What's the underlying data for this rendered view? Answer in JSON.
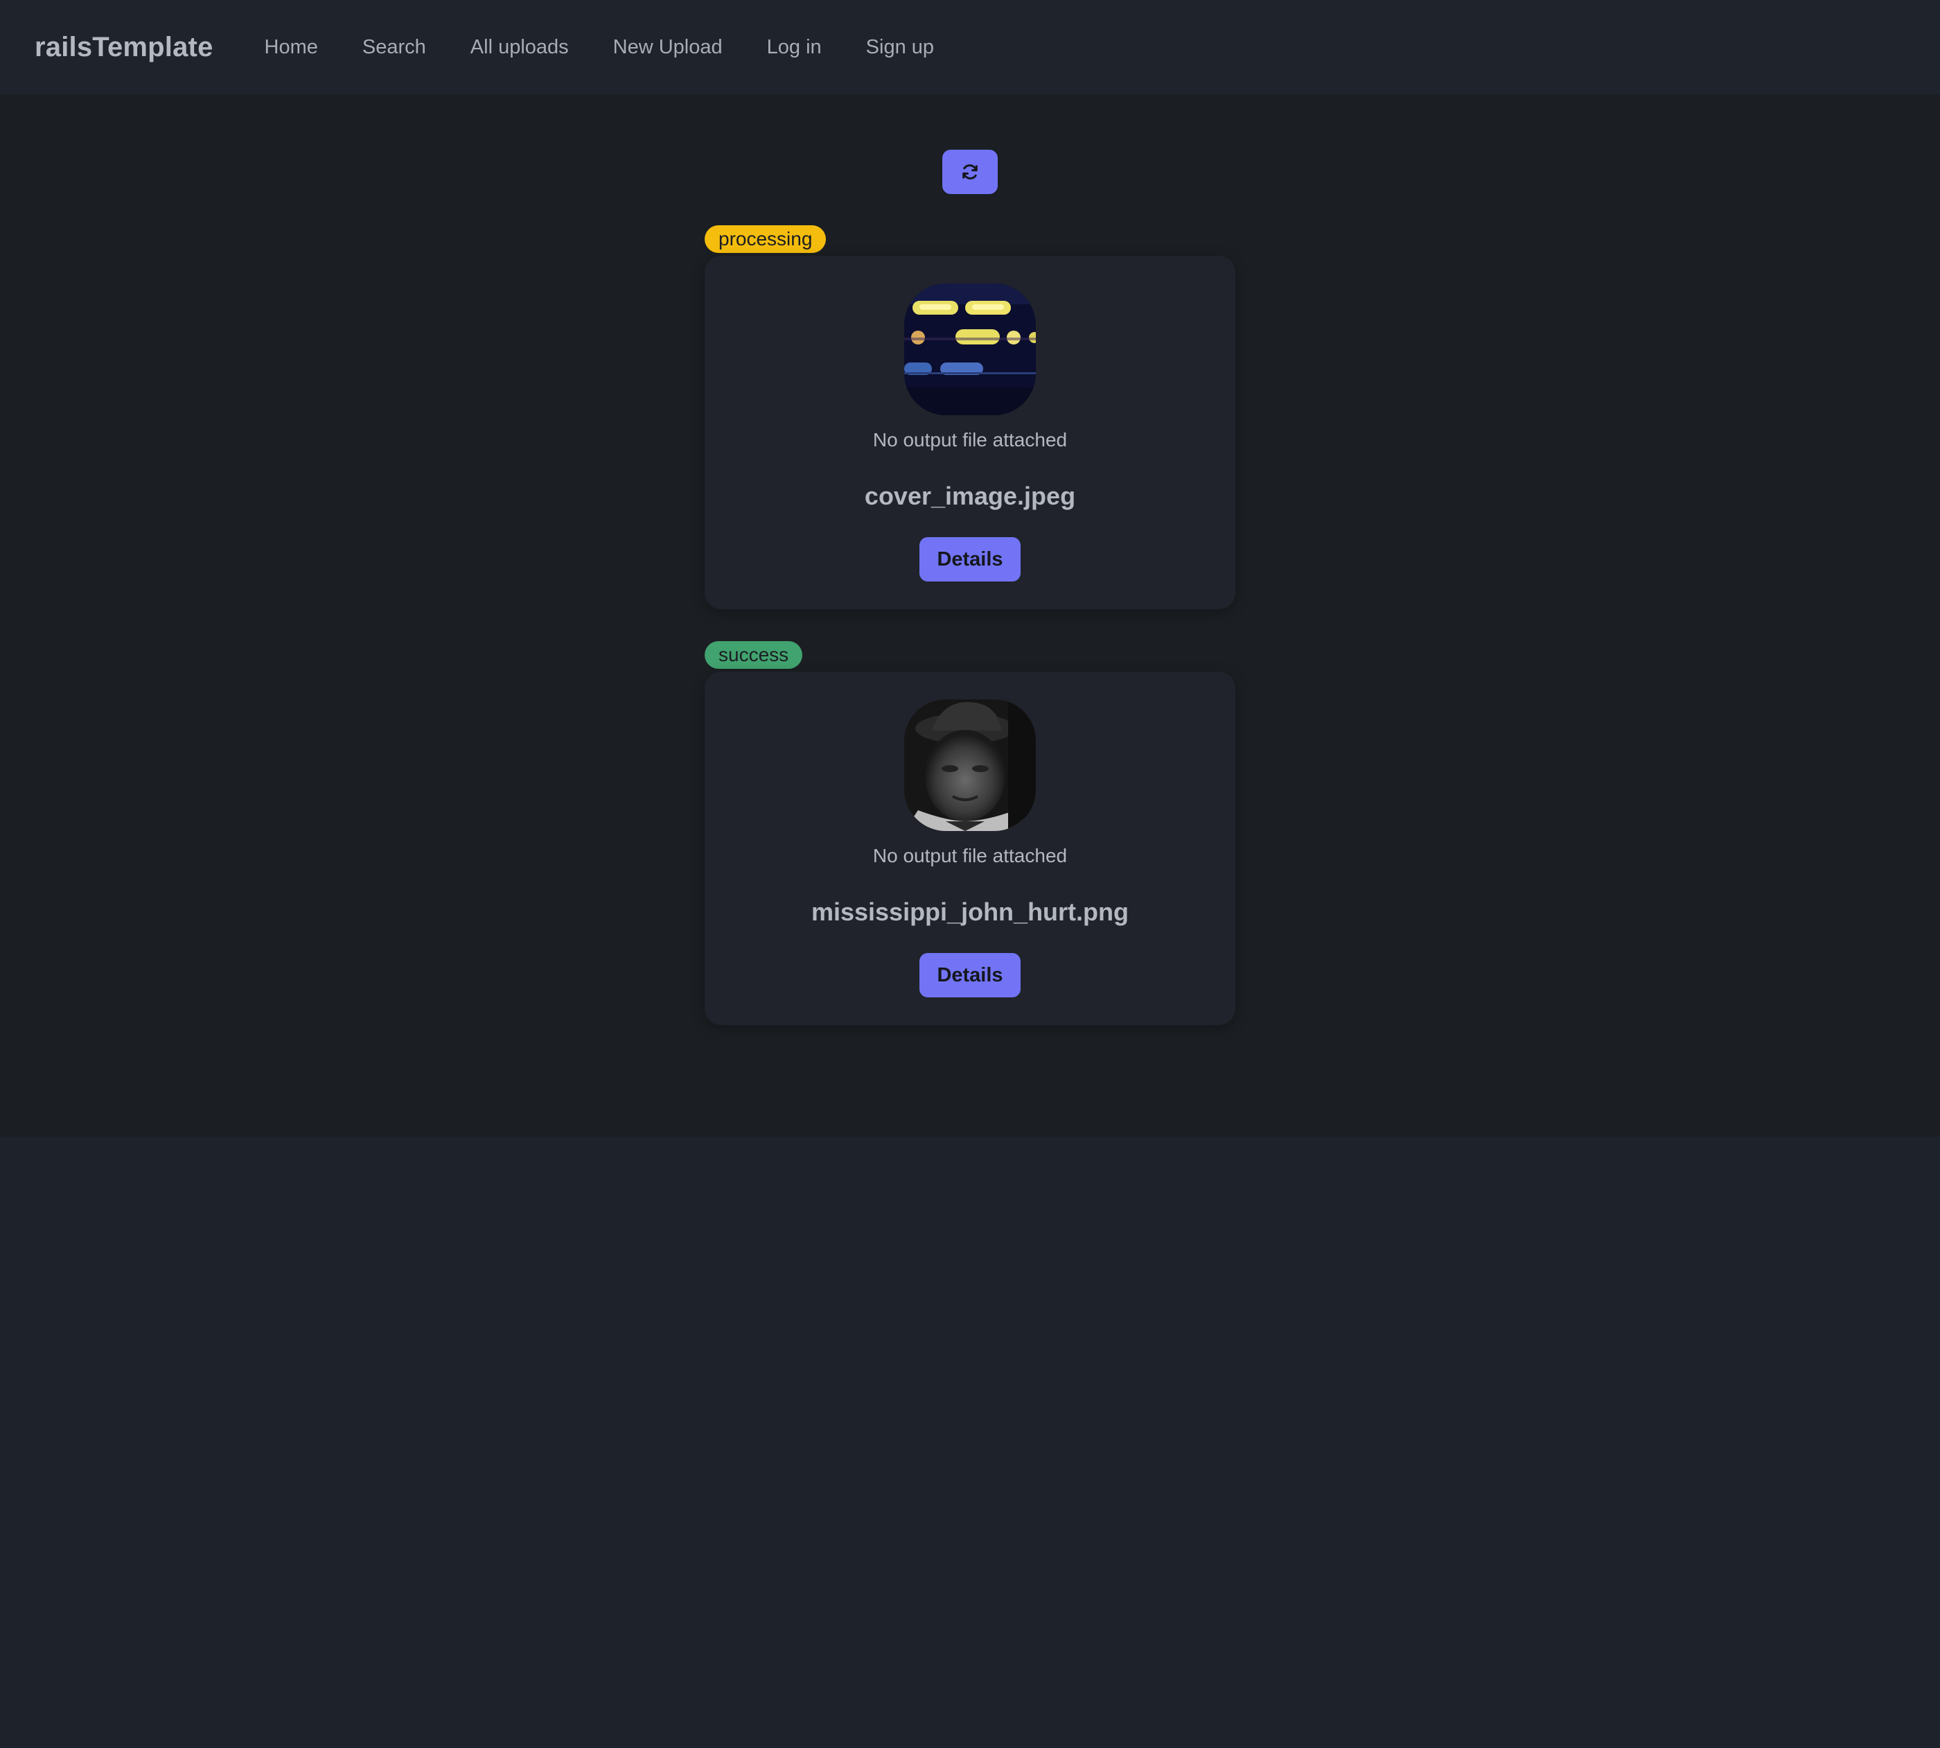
{
  "navbar": {
    "brand": "railsTemplate",
    "items": [
      {
        "label": "Home"
      },
      {
        "label": "Search"
      },
      {
        "label": "All uploads"
      },
      {
        "label": "New Upload"
      },
      {
        "label": "Log in"
      },
      {
        "label": "Sign up"
      }
    ]
  },
  "refresh": {
    "icon": "refresh-icon"
  },
  "uploads": [
    {
      "status": "processing",
      "status_color": "#f5bd0d",
      "output_text": "No output file attached",
      "filename": "cover_image.jpeg",
      "details_label": "Details"
    },
    {
      "status": "success",
      "status_color": "#41a36f",
      "output_text": "No output file attached",
      "filename": "mississippi_john_hurt.png",
      "details_label": "Details"
    }
  ],
  "colors": {
    "accent": "#7274f5",
    "background": "#1e222a",
    "content_background": "#1b1e22",
    "card_background": "#20232b"
  }
}
